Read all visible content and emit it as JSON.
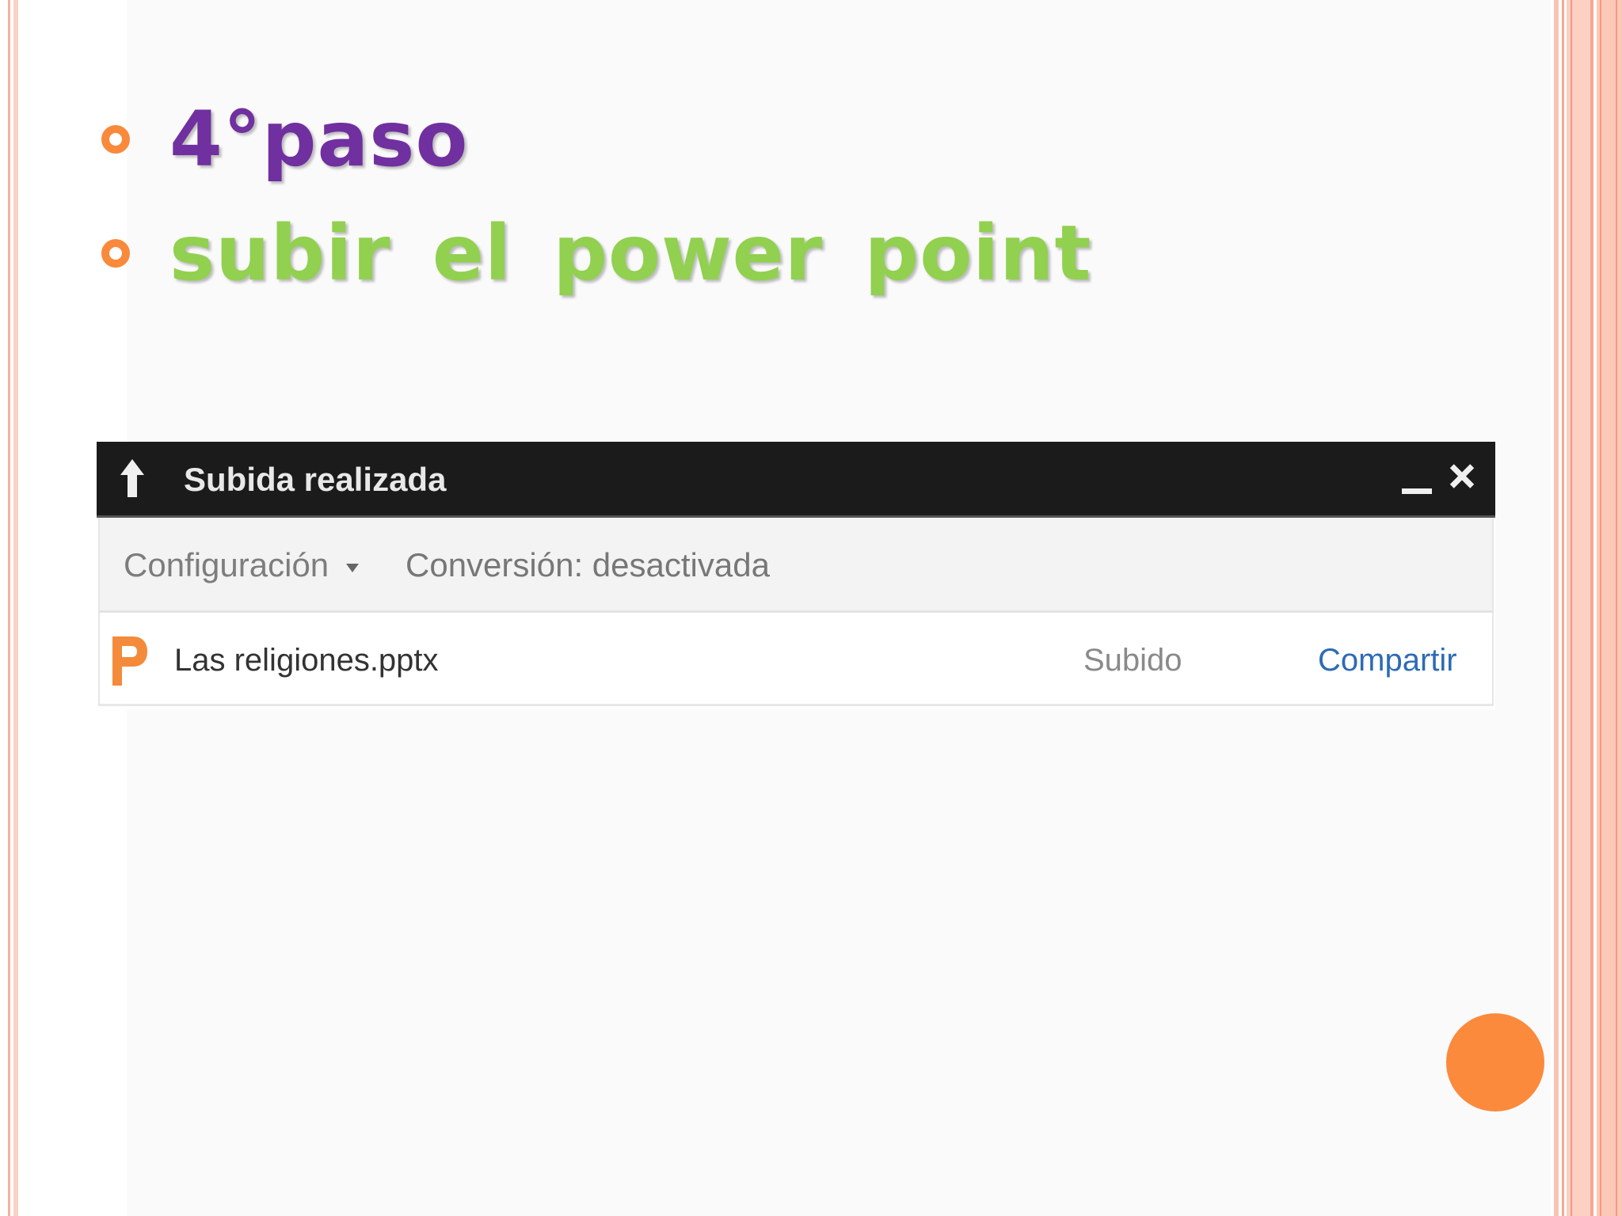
{
  "slide": {
    "bullets": [
      {
        "text": "4°paso",
        "color": "#7030a0"
      },
      {
        "text": "subir el power point",
        "color": "#92d050"
      }
    ],
    "bullet_color": "#f98a3c",
    "accent_circle_color": "#fb8a3c"
  },
  "upload_panel": {
    "title": "Subida realizada",
    "title_icon": "upload-arrow-icon",
    "controls": {
      "minimize_icon": "minimize-icon",
      "close_icon": "close-icon"
    },
    "toolbar": {
      "settings_label": "Configuración",
      "settings_icon": "caret-down-icon",
      "conversion_status": "Conversión: desactivada"
    },
    "files": [
      {
        "icon": "powerpoint-icon",
        "name": "Las religiones.pptx",
        "status": "Subido",
        "action": "Compartir"
      }
    ],
    "colors": {
      "header_bg": "#1b1b1b",
      "toolbar_bg": "#f3f3f4",
      "link": "#2d6bb5",
      "file_icon": "#f38b3a"
    }
  }
}
